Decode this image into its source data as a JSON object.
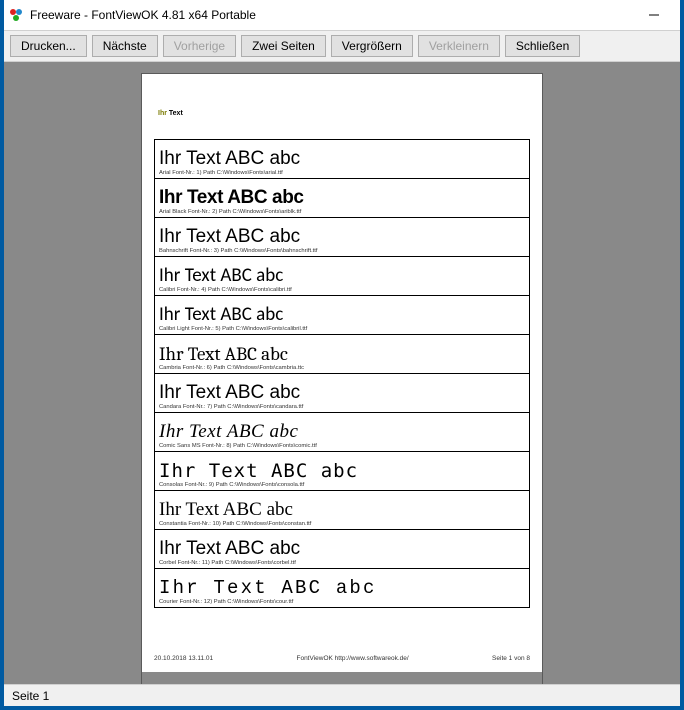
{
  "window": {
    "title": "Freeware - FontViewOK 4.81 x64 Portable"
  },
  "toolbar": {
    "print": "Drucken...",
    "next": "Nächste",
    "prev": "Vorherige",
    "two_pages": "Zwei Seiten",
    "zoom_in": "Vergrößern",
    "zoom_out": "Verkleinern",
    "close": "Schließen"
  },
  "paper": {
    "title_ihr": "Ihr",
    "title_text": " Text",
    "sample_text": "Ihr Text ABC abc",
    "rows": [
      {
        "css": "f-arial",
        "meta": "Arial Font-Nr.: 1) Path C:\\Windows\\Fonts\\arial.ttf"
      },
      {
        "css": "f-arialblack",
        "meta": "Arial Black Font-Nr.: 2) Path C:\\Windows\\Fonts\\ariblk.ttf"
      },
      {
        "css": "f-bahnschrift",
        "meta": "Bahnschrift Font-Nr.: 3) Path C:\\Windows\\Fonts\\bahnschrift.ttf"
      },
      {
        "css": "f-calibri",
        "meta": "Calibri Font-Nr.: 4) Path C:\\Windows\\Fonts\\calibri.ttf"
      },
      {
        "css": "f-calibril",
        "meta": "Calibri Light Font-Nr.: 5) Path C:\\Windows\\Fonts\\calibril.ttf"
      },
      {
        "css": "f-cambria",
        "meta": "Cambria Font-Nr.: 6) Path C:\\Windows\\Fonts\\cambria.ttc"
      },
      {
        "css": "f-candara",
        "meta": "Candara Font-Nr.: 7) Path C:\\Windows\\Fonts\\candara.ttf"
      },
      {
        "css": "f-comic",
        "meta": "Comic Sans MS Font-Nr.: 8) Path C:\\Windows\\Fonts\\comic.ttf"
      },
      {
        "css": "f-consolas",
        "meta": "Consolas Font-Nr.: 9) Path C:\\Windows\\Fonts\\consola.ttf"
      },
      {
        "css": "f-constantia",
        "meta": "Constantia Font-Nr.: 10) Path C:\\Windows\\Fonts\\constan.ttf"
      },
      {
        "css": "f-corbel",
        "meta": "Corbel Font-Nr.: 11) Path C:\\Windows\\Fonts\\corbel.ttf"
      },
      {
        "css": "f-courier",
        "meta": "Courier Font-Nr.: 12) Path C:\\Windows\\Fonts\\cour.ttf"
      }
    ],
    "footer_left": "20.10.2018  13.11.01",
    "footer_center": "FontViewOK http://www.softwareok.de/",
    "footer_right": "Seite 1 von 8"
  },
  "statusbar": {
    "text": "Seite 1"
  }
}
